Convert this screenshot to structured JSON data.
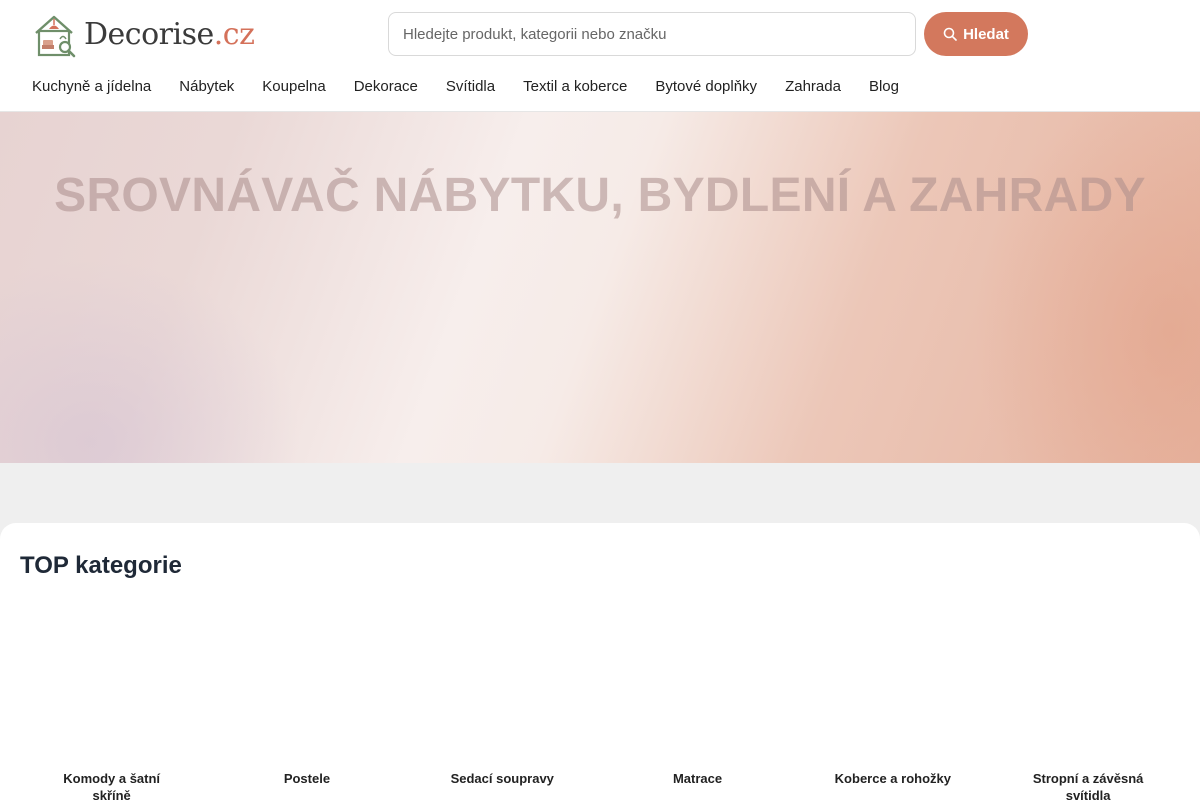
{
  "logo": {
    "text_main": "Decorise",
    "text_accent": ".cz"
  },
  "search": {
    "placeholder": "Hledejte produkt, kategorii nebo značku",
    "button_label": "Hledat"
  },
  "nav": [
    "Kuchyně a jídelna",
    "Nábytek",
    "Koupelna",
    "Dekorace",
    "Svítidla",
    "Textil a koberce",
    "Bytové doplňky",
    "Zahrada",
    "Blog"
  ],
  "hero": {
    "title": "SROVNÁVAČ NÁBYTKU, BYDLENÍ A ZAHRADY"
  },
  "top_categories": {
    "title": "TOP kategorie",
    "items": [
      "Komody a šatní skříně",
      "Postele",
      "Sedací soupravy",
      "Matrace",
      "Koberce a rohožky",
      "Stropní a závěsná svítidla"
    ]
  },
  "colors": {
    "accent": "#d3785d",
    "hero_title": "#aa8c8a"
  }
}
